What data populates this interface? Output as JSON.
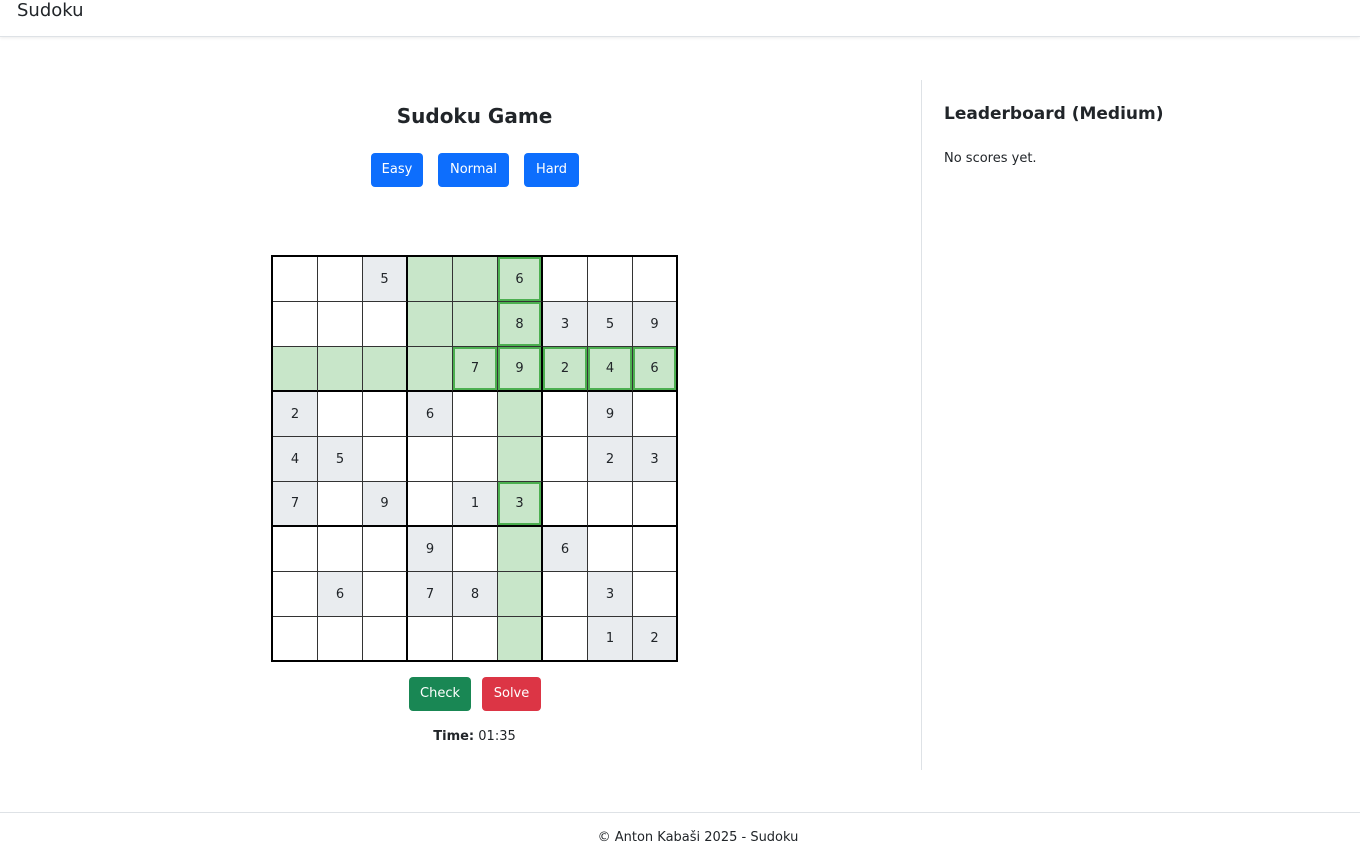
{
  "navbar": {
    "brand": "Sudoku"
  },
  "game": {
    "title": "Sudoku Game",
    "difficulty_buttons": [
      "Easy",
      "Normal",
      "Hard"
    ],
    "board": [
      [
        "",
        "",
        "5",
        "",
        "",
        "6",
        "",
        "",
        ""
      ],
      [
        "",
        "",
        "",
        "",
        "",
        "8",
        "3",
        "5",
        "9"
      ],
      [
        "",
        "",
        "",
        "",
        "7",
        "9",
        "2",
        "4",
        "6"
      ],
      [
        "2",
        "",
        "",
        "6",
        "",
        "",
        "",
        "9",
        ""
      ],
      [
        "4",
        "5",
        "",
        "",
        "",
        "",
        "",
        "2",
        "3"
      ],
      [
        "7",
        "",
        "9",
        "",
        "1",
        "3",
        "",
        "",
        ""
      ],
      [
        "",
        "",
        "",
        "9",
        "",
        "",
        "6",
        "",
        ""
      ],
      [
        "",
        "6",
        "",
        "7",
        "8",
        "",
        "",
        "3",
        ""
      ],
      [
        "",
        "",
        "",
        "",
        "",
        "",
        "",
        "1",
        "2"
      ]
    ],
    "highlight_row": 2,
    "highlight_col": 5,
    "matching_digit_cells": [
      [
        0,
        5
      ],
      [
        1,
        5
      ],
      [
        2,
        4
      ],
      [
        2,
        5
      ],
      [
        2,
        6
      ],
      [
        2,
        7
      ],
      [
        2,
        8
      ],
      [
        5,
        5
      ]
    ],
    "colors": {
      "given": "#e9ecef",
      "highlight": "#c8e6c9",
      "selected_border": "#4caf50"
    },
    "check_label": "Check",
    "solve_label": "Solve",
    "timer_label": "Time:",
    "timer_value": "01:35"
  },
  "leaderboard": {
    "title": "Leaderboard (Medium)",
    "empty_text": "No scores yet."
  },
  "footer": {
    "text": "© Anton Kabaši 2025 - Sudoku"
  },
  "colors": {
    "primary": "#0d6efd",
    "success": "#198754",
    "danger": "#dc3545"
  }
}
